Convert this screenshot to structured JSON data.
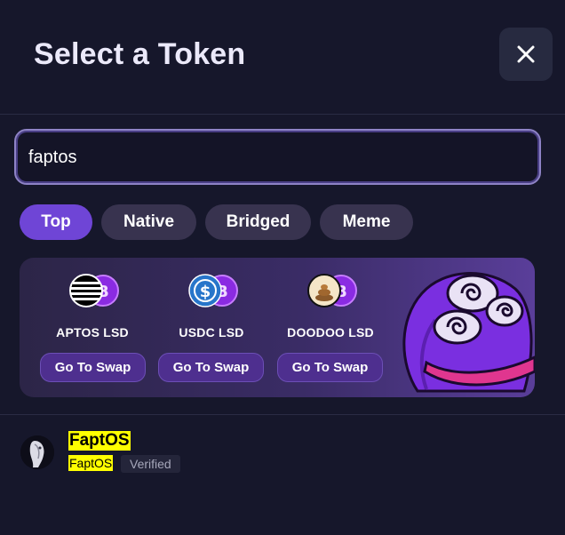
{
  "modal": {
    "title": "Select a Token"
  },
  "search": {
    "value": "faptos",
    "placeholder": ""
  },
  "tabs": [
    {
      "label": "Top",
      "active": true
    },
    {
      "label": "Native",
      "active": false
    },
    {
      "label": "Bridged",
      "active": false
    },
    {
      "label": "Meme",
      "active": false
    }
  ],
  "promos": [
    {
      "label": "APTOS LSD",
      "button": "Go To Swap",
      "icon": "aptos-icon"
    },
    {
      "label": "USDC LSD",
      "button": "Go To Swap",
      "icon": "usdc-icon"
    },
    {
      "label": "DOODOO LSD",
      "button": "Go To Swap",
      "icon": "doodoo-icon"
    }
  ],
  "results": [
    {
      "name": "FaptOS",
      "symbol": "FaptOS",
      "badge": "Verified",
      "icon": "faptos-avatar"
    }
  ],
  "colors": {
    "background": "#16172b",
    "accent": "#6f45d6",
    "highlight": "#ffff00"
  }
}
